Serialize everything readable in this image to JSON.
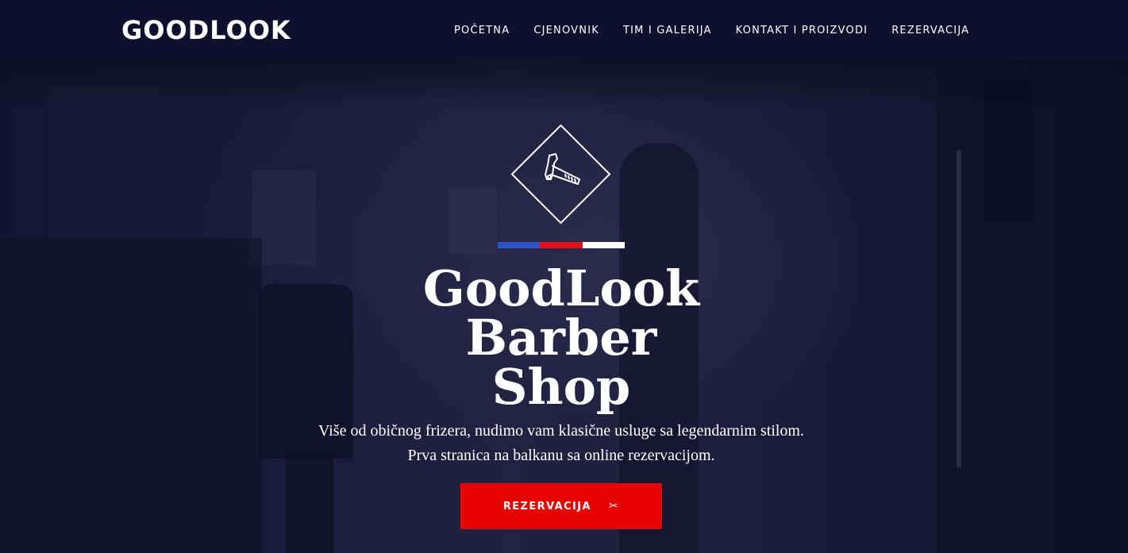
{
  "nav": {
    "logo": "GOODLOOK",
    "links": [
      {
        "label": "POČETNA"
      },
      {
        "label": "CJENOVNIK"
      },
      {
        "label": "TIM I GALERIJA"
      },
      {
        "label": "KONTAKT I PROIZVODI"
      },
      {
        "label": "REZERVACIJA"
      }
    ]
  },
  "hero": {
    "badge_icon": "straight-razor-icon",
    "stripe_colors": [
      "#2a55c8",
      "#e3101c",
      "#ffffff"
    ],
    "title_lines": [
      "GoodLook",
      "Barber",
      "Shop"
    ],
    "subtitle_lines": [
      "Više od običnog frizera, nudimo vam klasične usluge sa legendarnim stilom.",
      "Prva stranica na balkanu sa online rezervacijom."
    ],
    "cta": {
      "label": "REZERVACIJA",
      "icon": "scissors-icon",
      "color": "#e60000"
    }
  },
  "colors": {
    "nav_bg": "#0f0f2e",
    "accent": "#e60000"
  }
}
